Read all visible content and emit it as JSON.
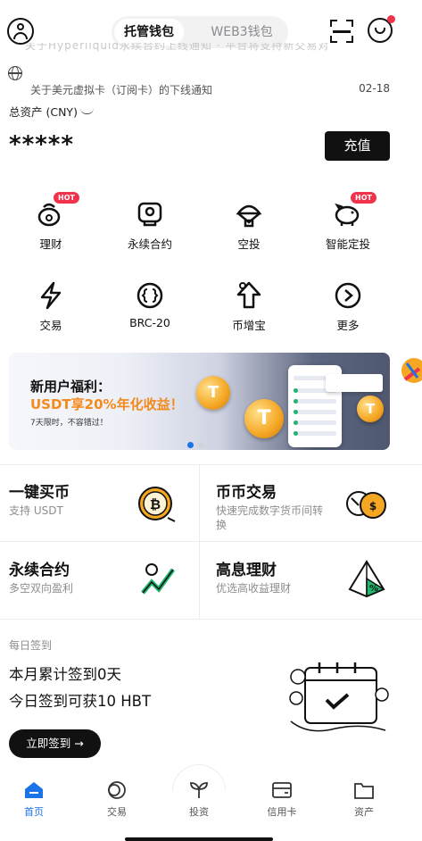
{
  "header": {
    "wallet_tabs": [
      {
        "label": "托管钱包",
        "active": true
      },
      {
        "label": "WEB3钱包",
        "active": false
      }
    ]
  },
  "announcement": {
    "faded_text": "关于Hyperliquid永续合约上线通知 · 平台将支持新交易对",
    "text": "关于美元虚拟卡（订阅卡）的下线通知",
    "date": "02-18"
  },
  "assets": {
    "label": "总资产 (CNY)",
    "value": "*****",
    "recharge_label": "充值"
  },
  "quick_grid": [
    {
      "label": "理财",
      "icon": "piggy-money-icon",
      "hot": true
    },
    {
      "label": "永续合约",
      "icon": "contract-icon",
      "hot": false
    },
    {
      "label": "空投",
      "icon": "airdrop-parachute-icon",
      "hot": false
    },
    {
      "label": "智能定投",
      "icon": "piggy-bank-icon",
      "hot": true
    },
    {
      "label": "交易",
      "icon": "lightning-icon",
      "hot": false
    },
    {
      "label": "BRC-20",
      "icon": "brc20-icon",
      "hot": false
    },
    {
      "label": "币增宝",
      "icon": "arrow-up-icon",
      "hot": false
    },
    {
      "label": "更多",
      "icon": "more-arrow-icon",
      "hot": false
    }
  ],
  "hot_badge": "HOT",
  "banner": {
    "title": "新用户福利：",
    "subtitle": "USDT享20%年化收益！",
    "note": "7天限时，不容错过！",
    "page_count": 2,
    "active_page": 1
  },
  "feature_cards": [
    {
      "title": "一键买币",
      "subtitle": "支持 USDT",
      "icon": "bitcoin-coin-icon"
    },
    {
      "title": "币币交易",
      "subtitle": "快速完成数字货币间转换",
      "icon": "exchange-coins-icon"
    },
    {
      "title": "永续合约",
      "subtitle": "多空双向盈利",
      "icon": "trend-chart-icon"
    },
    {
      "title": "高息理财",
      "subtitle": "优选高收益理财",
      "icon": "percent-pyramid-icon"
    }
  ],
  "sign_in": {
    "label": "每日签到",
    "line1": "本月累计签到0天",
    "line2": "今日签到可获10 HBT",
    "button": "立即签到 →"
  },
  "bottom_nav": [
    {
      "label": "首页",
      "icon": "home-icon",
      "active": true
    },
    {
      "label": "交易",
      "icon": "trade-icon",
      "active": false
    },
    {
      "label": "投资",
      "icon": "sprout-icon",
      "active": false
    },
    {
      "label": "信用卡",
      "icon": "credit-card-icon",
      "active": false
    },
    {
      "label": "资产",
      "icon": "folder-icon",
      "active": false
    }
  ],
  "colors": {
    "accent_blue": "#1a73e8",
    "hot_red": "#f0324b",
    "banner_orange": "#f28a1c",
    "check_green": "#21b56e"
  }
}
